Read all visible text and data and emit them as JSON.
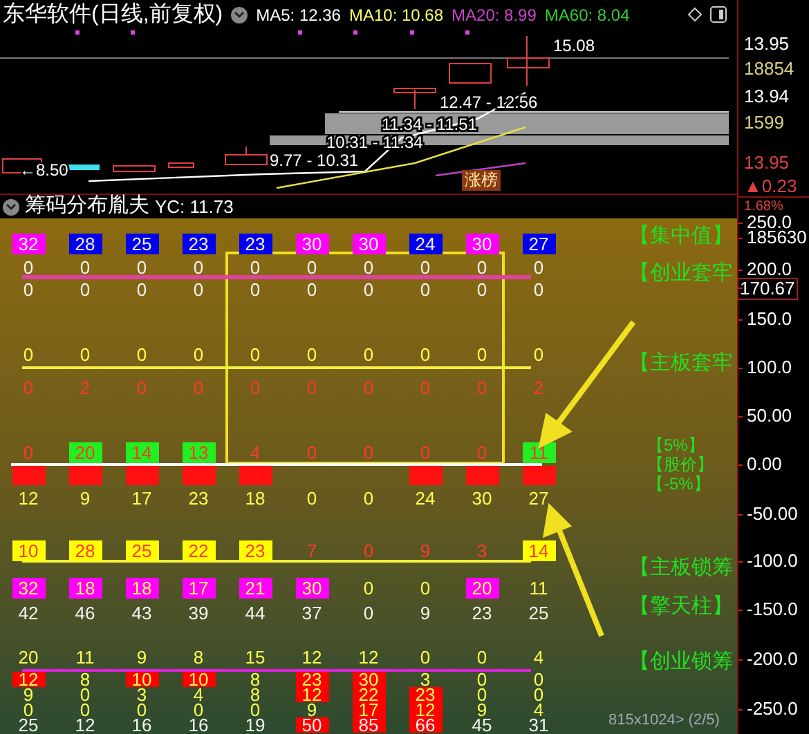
{
  "header": {
    "title": "东华软件(日线,前复权)",
    "indicators": [
      {
        "label": "MA5:",
        "value": "12.36",
        "color": "#ffffff"
      },
      {
        "label": "MA10:",
        "value": "10.68",
        "color": "#ffff66"
      },
      {
        "label": "MA20:",
        "value": "8.99",
        "color": "#cc44cc"
      },
      {
        "label": "MA60:",
        "value": "8.04",
        "color": "#33cc33"
      }
    ]
  },
  "price_chart": {
    "labels": [
      "15.08",
      "12.47 - 12.56",
      "11.34 - 11.51",
      "10.31 - 11.34",
      "9.77 - 10.31",
      "←8.50"
    ],
    "tag": "涨榜"
  },
  "price_axis": [
    {
      "text": "13.95",
      "kind": "price"
    },
    {
      "text": "18854",
      "kind": "volume"
    },
    {
      "text": "13.94",
      "kind": "price"
    },
    {
      "text": "1599",
      "kind": "volume"
    },
    {
      "text": "13.95",
      "kind": "change"
    },
    {
      "text": "▲0.23",
      "kind": "change"
    },
    {
      "text": "1.68%",
      "kind": "change"
    }
  ],
  "chip_panel": {
    "title": "筹码分布胤夫",
    "yc": "YC: 11.73",
    "rows": [
      {
        "kind": "white",
        "cells": [
          {
            "text": "32",
            "color": "#ff00ff"
          },
          {
            "text": "28",
            "color": "#0000ee"
          },
          {
            "text": "25",
            "color": "#0000ee"
          },
          {
            "text": "23",
            "color": "#0000ee"
          },
          {
            "text": "23",
            "color": "#0000ee"
          },
          {
            "text": "30",
            "color": "#ff00ff"
          },
          {
            "text": "30",
            "color": "#ff00ff"
          },
          {
            "text": "24",
            "color": "#0000ee"
          },
          {
            "text": "30",
            "color": "#ff00ff"
          },
          {
            "text": "27",
            "color": "#0000ee"
          }
        ]
      },
      {
        "kind": "white",
        "cells": [
          {
            "text": "0"
          },
          {
            "text": "0"
          },
          {
            "text": "0"
          },
          {
            "text": "0"
          },
          {
            "text": "0"
          },
          {
            "text": "0"
          },
          {
            "text": "0"
          },
          {
            "text": "0"
          },
          {
            "text": "0"
          },
          {
            "text": "0"
          }
        ]
      },
      {
        "kind": "white",
        "cells": [
          {
            "text": "0"
          },
          {
            "text": "0"
          },
          {
            "text": "0"
          },
          {
            "text": "0"
          },
          {
            "text": "0"
          },
          {
            "text": "0"
          },
          {
            "text": "0"
          },
          {
            "text": "0"
          },
          {
            "text": "0"
          },
          {
            "text": "0"
          }
        ]
      },
      {
        "kind": "yellow",
        "cells": [
          {
            "text": "0"
          },
          {
            "text": "0"
          },
          {
            "text": "0"
          },
          {
            "text": "0"
          },
          {
            "text": "0"
          },
          {
            "text": "0"
          },
          {
            "text": "0"
          },
          {
            "text": "0"
          },
          {
            "text": "0"
          },
          {
            "text": "0"
          }
        ]
      },
      {
        "kind": "red",
        "cells": [
          {
            "text": "0"
          },
          {
            "text": "2"
          },
          {
            "text": "0"
          },
          {
            "text": "0"
          },
          {
            "text": "0"
          },
          {
            "text": "0"
          },
          {
            "text": "0"
          },
          {
            "text": "0"
          },
          {
            "text": "0"
          },
          {
            "text": "2"
          }
        ]
      },
      {
        "kind": "red",
        "cells": [
          {
            "text": "0"
          },
          {
            "text": "20",
            "color": "#22ee22"
          },
          {
            "text": "14",
            "color": "#22ee22"
          },
          {
            "text": "13",
            "color": "#22ee22"
          },
          {
            "text": "4"
          },
          {
            "text": "0"
          },
          {
            "text": "0"
          },
          {
            "text": "0"
          },
          {
            "text": "0"
          },
          {
            "text": "11",
            "color": "#22ee22"
          }
        ]
      },
      {
        "kind": "yellow",
        "cells": [
          {
            "text": "12"
          },
          {
            "text": "9"
          },
          {
            "text": "17"
          },
          {
            "text": "23"
          },
          {
            "text": "18"
          },
          {
            "text": "0"
          },
          {
            "text": "0"
          },
          {
            "text": "24"
          },
          {
            "text": "30"
          },
          {
            "text": "27"
          }
        ]
      },
      {
        "kind": "red",
        "cells": [
          {
            "text": "10",
            "color": "#ffff00"
          },
          {
            "text": "28",
            "color": "#ffff00"
          },
          {
            "text": "25",
            "color": "#ffff00"
          },
          {
            "text": "22",
            "color": "#ffff00"
          },
          {
            "text": "23",
            "color": "#ffff00"
          },
          {
            "text": "7"
          },
          {
            "text": "0"
          },
          {
            "text": "9"
          },
          {
            "text": "3"
          },
          {
            "text": "14",
            "color": "#ffff00"
          }
        ]
      },
      {
        "kind": "yellow",
        "cells": [
          {
            "text": "32",
            "color": "#ff00ff"
          },
          {
            "text": "18",
            "color": "#ff00ff"
          },
          {
            "text": "18",
            "color": "#ff00ff"
          },
          {
            "text": "17",
            "color": "#ff00ff"
          },
          {
            "text": "21",
            "color": "#ff00ff"
          },
          {
            "text": "30",
            "color": "#ff00ff"
          },
          {
            "text": "0"
          },
          {
            "text": "0"
          },
          {
            "text": "20",
            "color": "#ff00ff"
          },
          {
            "text": "11"
          }
        ]
      },
      {
        "kind": "white",
        "cells": [
          {
            "text": "42"
          },
          {
            "text": "46"
          },
          {
            "text": "43"
          },
          {
            "text": "39"
          },
          {
            "text": "44"
          },
          {
            "text": "37"
          },
          {
            "text": "0"
          },
          {
            "text": "9"
          },
          {
            "text": "23"
          },
          {
            "text": "25"
          }
        ]
      },
      {
        "kind": "yellow",
        "cells": [
          {
            "text": "20"
          },
          {
            "text": "11"
          },
          {
            "text": "9"
          },
          {
            "text": "8"
          },
          {
            "text": "15"
          },
          {
            "text": "12"
          },
          {
            "text": "12"
          },
          {
            "text": "0"
          },
          {
            "text": "0"
          },
          {
            "text": "4"
          }
        ]
      },
      {
        "kind": "yellow",
        "cells": [
          {
            "text": "12",
            "color": "#ff0000"
          },
          {
            "text": "8"
          },
          {
            "text": "10",
            "color": "#ff0000"
          },
          {
            "text": "10",
            "color": "#ff0000"
          },
          {
            "text": "8"
          },
          {
            "text": "23",
            "color": "#ff0000"
          },
          {
            "text": "30",
            "color": "#ff0000"
          },
          {
            "text": "3"
          },
          {
            "text": "0"
          },
          {
            "text": "0"
          }
        ]
      },
      {
        "kind": "yellow",
        "cells": [
          {
            "text": "9"
          },
          {
            "text": "0"
          },
          {
            "text": "3"
          },
          {
            "text": "4"
          },
          {
            "text": "8"
          },
          {
            "text": "12",
            "color": "#ff0000"
          },
          {
            "text": "22",
            "color": "#ff0000"
          },
          {
            "text": "23",
            "color": "#ff0000"
          },
          {
            "text": "0"
          },
          {
            "text": "0"
          }
        ]
      },
      {
        "kind": "yellow",
        "cells": [
          {
            "text": "0"
          },
          {
            "text": "0"
          },
          {
            "text": "0"
          },
          {
            "text": "0"
          },
          {
            "text": "0"
          },
          {
            "text": "9"
          },
          {
            "text": "17",
            "color": "#ff0000"
          },
          {
            "text": "12",
            "color": "#ff0000"
          },
          {
            "text": "9"
          },
          {
            "text": "4"
          }
        ]
      },
      {
        "kind": "white",
        "cells": [
          {
            "text": "25"
          },
          {
            "text": "12"
          },
          {
            "text": "16"
          },
          {
            "text": "16"
          },
          {
            "text": "19"
          },
          {
            "text": "50",
            "color": "#ff0000"
          },
          {
            "text": "85",
            "color": "#ff0000"
          },
          {
            "text": "66",
            "color": "#ff0000"
          },
          {
            "text": "45"
          },
          {
            "text": "31"
          }
        ]
      }
    ],
    "bars": [
      true,
      true,
      true,
      true,
      true,
      false,
      false,
      true,
      true,
      true
    ],
    "side_labels": [
      "【集中值】",
      "【创业套牢",
      "【主板套牢",
      "【5%】",
      "【股价】",
      "【-5%】",
      "【主板锁筹",
      "【擎天柱】",
      "【创业锁筹"
    ],
    "footer": "815x1024> (2/5)"
  },
  "chip_axis": [
    {
      "text": "250.0",
      "boxed": false
    },
    {
      "text": "185630",
      "boxed": false
    },
    {
      "text": "200.0",
      "boxed": false
    },
    {
      "text": "170.67",
      "boxed": true
    },
    {
      "text": "150.0",
      "boxed": false
    },
    {
      "text": "100.0",
      "boxed": false
    },
    {
      "text": "50.00",
      "boxed": false
    },
    {
      "text": "0.00",
      "boxed": false
    },
    {
      "text": "-50.00",
      "boxed": false
    },
    {
      "text": "-100.0",
      "boxed": false
    },
    {
      "text": "-150.0",
      "boxed": false
    },
    {
      "text": "-200.0",
      "boxed": false
    },
    {
      "text": "-250.0",
      "boxed": false
    }
  ]
}
